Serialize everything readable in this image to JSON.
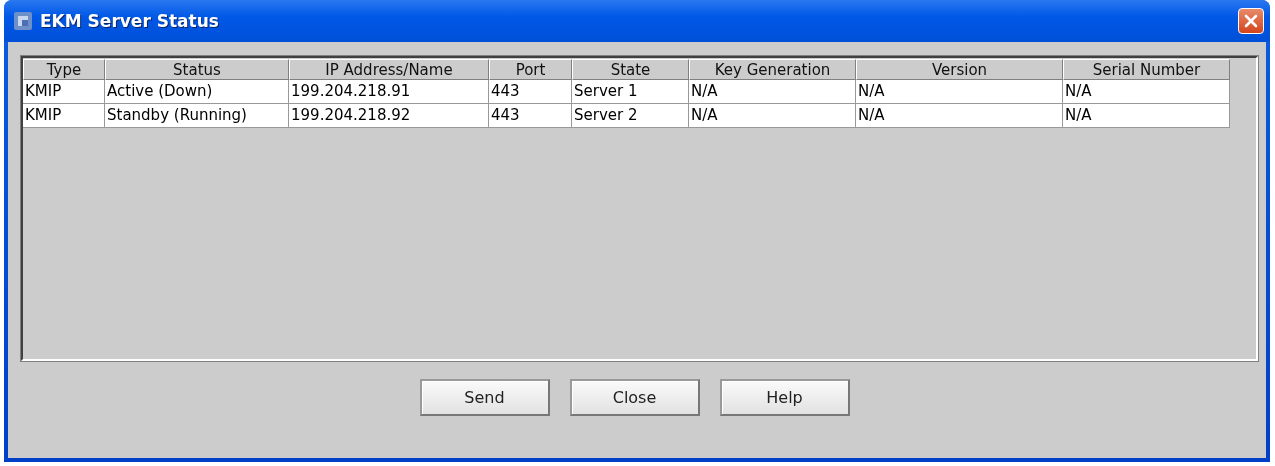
{
  "window": {
    "title": "EKM Server Status"
  },
  "table": {
    "columns": [
      "Type",
      "Status",
      "IP Address/Name",
      "Port",
      "State",
      "Key Generation",
      "Version",
      "Serial Number"
    ],
    "rows": [
      [
        "KMIP",
        "Active (Down)",
        "199.204.218.91",
        "443",
        "Server 1",
        "N/A",
        "N/A",
        "N/A"
      ],
      [
        "KMIP",
        "Standby (Running)",
        "199.204.218.92",
        "443",
        "Server 2",
        "N/A",
        "N/A",
        "N/A"
      ]
    ]
  },
  "buttons": [
    "Send",
    "Close",
    "Help"
  ]
}
